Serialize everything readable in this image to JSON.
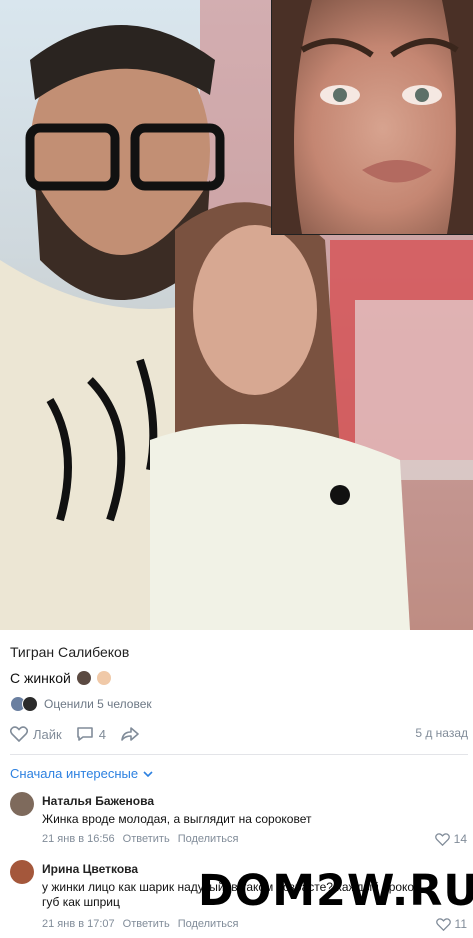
{
  "post": {
    "author": "Тигран Салибеков",
    "text": "С жинкой",
    "liked_by_text": "Оценили 5 человек",
    "like_label": "Лайк",
    "comments_count": "4",
    "time_ago": "5 д назад"
  },
  "sort_label": "Сначала интересные",
  "comments": [
    {
      "name": "Наталья Баженова",
      "text": "Жинка вроде молодая, а выглядит на сороковет",
      "date": "21 янв в 16:56",
      "reply": "Ответить",
      "share": "Поделиться",
      "likes": "14"
    },
    {
      "name": "Ирина Цветкова",
      "text": "у жинки лицо как шарик надутый, в таком возрасте? каждый прокол губ как шприц",
      "date": "21 янв в 17:07",
      "reply": "Ответить",
      "share": "Поделиться",
      "likes": "11"
    }
  ],
  "watermark": "DOM2W.RU",
  "colors": {
    "link": "#2d81e0",
    "muted": "#818c99"
  },
  "icons": [
    "heart-icon",
    "comment-icon",
    "share-icon",
    "chevron-down-icon"
  ]
}
